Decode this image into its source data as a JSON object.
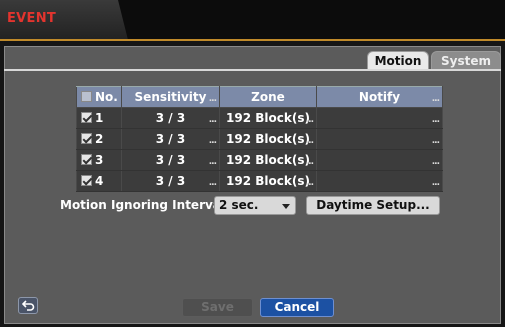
{
  "header": {
    "title": "EVENT"
  },
  "tabs": [
    {
      "label": "Motion",
      "active": true
    },
    {
      "label": "System",
      "active": false
    }
  ],
  "table": {
    "columns": [
      "No.",
      "Sensitivity",
      "Zone",
      "Notify"
    ],
    "column_more": "...",
    "header_checked": false,
    "rows": [
      {
        "no": "1",
        "checked": true,
        "sensitivity": "3 / 3",
        "zone": "192 Block(s)",
        "notify": ""
      },
      {
        "no": "2",
        "checked": true,
        "sensitivity": "3 / 3",
        "zone": "192 Block(s)",
        "notify": ""
      },
      {
        "no": "3",
        "checked": true,
        "sensitivity": "3 / 3",
        "zone": "192 Block(s)",
        "notify": ""
      },
      {
        "no": "4",
        "checked": true,
        "sensitivity": "3 / 3",
        "zone": "192 Block(s)",
        "notify": ""
      }
    ]
  },
  "interval": {
    "label": "Motion Ignoring Interval",
    "value": "2 sec."
  },
  "daytime_button": "Daytime Setup...",
  "footer": {
    "save_label": "Save",
    "cancel_label": "Cancel",
    "save_enabled": false
  },
  "colors": {
    "title": "#e3342e",
    "accent": "#c08a2a",
    "header_row": "#7c8aa8",
    "cancel": "#1c51a3"
  }
}
